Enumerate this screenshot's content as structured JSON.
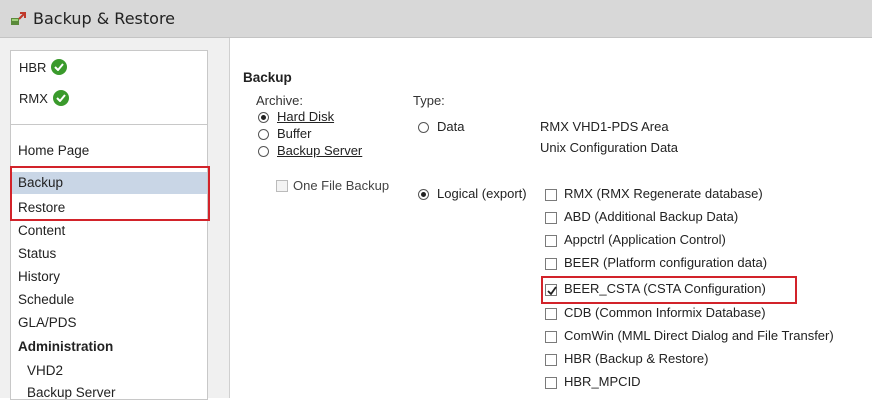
{
  "window": {
    "title": "Backup & Restore"
  },
  "status": [
    {
      "name": "HBR",
      "state": "ok"
    },
    {
      "name": "RMX",
      "state": "ok"
    }
  ],
  "nav": {
    "items": [
      {
        "label": "Home Page"
      },
      {
        "label": "Backup",
        "selected": true
      },
      {
        "label": "Restore"
      },
      {
        "label": "Content"
      },
      {
        "label": "Status"
      },
      {
        "label": "History"
      },
      {
        "label": "Schedule"
      },
      {
        "label": "GLA/PDS"
      },
      {
        "label": "Administration"
      },
      {
        "label": "VHD2"
      },
      {
        "label": "Backup Server"
      }
    ]
  },
  "backup": {
    "heading": "Backup",
    "archive_label": "Archive:",
    "type_label": "Type:",
    "archive_options": [
      {
        "label": "Hard Disk",
        "checked": true
      },
      {
        "label": "Buffer",
        "checked": false
      },
      {
        "label": "Backup Server",
        "checked": false
      }
    ],
    "one_file_backup": {
      "label": "One File Backup",
      "checked": false,
      "disabled": true
    },
    "type_options": [
      {
        "label": "Data",
        "checked": false
      },
      {
        "label": "Logical (export)",
        "checked": true
      }
    ],
    "data_items": [
      "RMX VHD1-PDS Area",
      "Unix Configuration Data"
    ],
    "logical_items": [
      {
        "label": "RMX (RMX Regenerate database)",
        "checked": false
      },
      {
        "label": "ABD (Additional Backup Data)",
        "checked": false
      },
      {
        "label": "Appctrl (Application Control)",
        "checked": false
      },
      {
        "label": "BEER (Platform configuration data)",
        "checked": false
      },
      {
        "label": "BEER_CSTA (CSTA Configuration)",
        "checked": true
      },
      {
        "label": "CDB (Common Informix Database)",
        "checked": false
      },
      {
        "label": "ComWin (MML Direct Dialog and File Transfer)",
        "checked": false
      },
      {
        "label": "HBR (Backup & Restore)",
        "checked": false
      },
      {
        "label": "HBR_MPCID",
        "checked": false
      }
    ]
  },
  "colors": {
    "highlight_border": "#d2232a",
    "selected_row": "#c9d6e6",
    "ok_badge": "#3a9a2c"
  }
}
